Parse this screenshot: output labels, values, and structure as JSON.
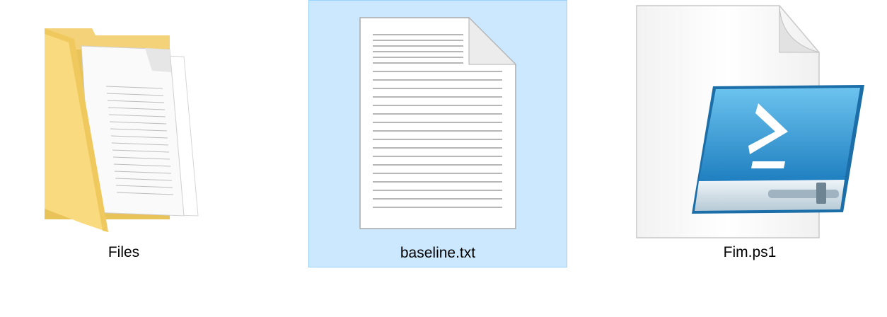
{
  "files": [
    {
      "label": "Files",
      "icon": "folder-icon",
      "selected": false
    },
    {
      "label": "baseline.txt",
      "icon": "text-document-icon",
      "selected": true
    },
    {
      "label": "Fim.ps1",
      "icon": "powershell-script-icon",
      "selected": false
    }
  ],
  "colors": {
    "selection_fill": "#cce8ff",
    "selection_border": "#99d1ff",
    "folder_yellow": "#f8d775",
    "powershell_blue": "#2a8fce"
  }
}
